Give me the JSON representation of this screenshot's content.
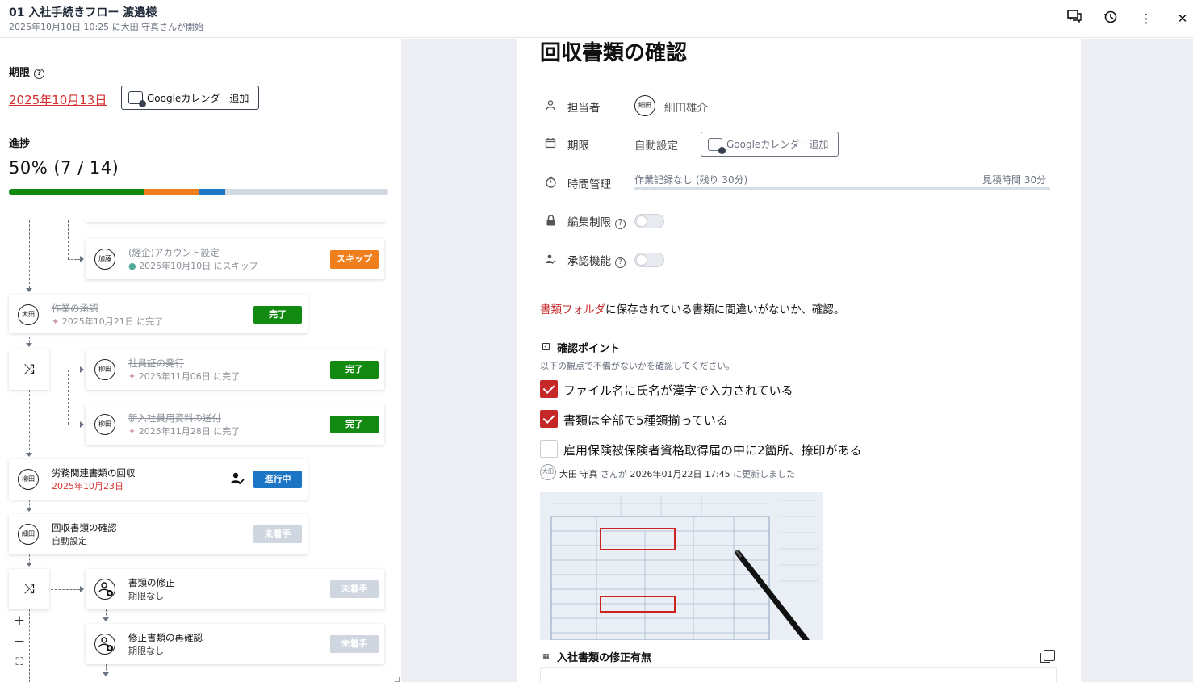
{
  "header": {
    "title": "01 入社手続きフロー 渡邉様",
    "subtitle": "2025年10月10日 10:25 に大田 守真さんが開始"
  },
  "sidebar": {
    "deadline_label": "期限",
    "deadline_value": "2025年10月13日",
    "gcal_label": "Googleカレンダー追加",
    "progress_label": "進捗",
    "progress_text": "50% (7 / 14)",
    "progress": {
      "done": 7,
      "total": 14,
      "segments": {
        "done_fraction": 0.357,
        "skipped_fraction": 0.143,
        "in_progress_fraction": 0.071
      }
    },
    "progress_colors": {
      "done": "#128a12",
      "skipped": "#ef7e1c",
      "in_progress": "#1b74c4",
      "remaining": "#d1d9e2"
    }
  },
  "flow": {
    "nodes": [
      {
        "avatar": "加藤",
        "title": "(経企)アカウント設定",
        "sub": "2025年10月10日 にスキップ",
        "status": "スキップ"
      },
      {
        "avatar": "大田",
        "title": "作業の承認",
        "sub": "2025年10月21日 に完了",
        "status": "完了"
      },
      {
        "avatar": "柳田",
        "title": "社員証の発行",
        "sub": "2025年11月06日 に完了",
        "status": "完了"
      },
      {
        "avatar": "柳田",
        "title": "新入社員用資料の送付",
        "sub": "2025年11月28日 に完了",
        "status": "完了"
      },
      {
        "avatar": "柳田",
        "title": "労務関連書類の回収",
        "sub": "2025年10月23日",
        "status": "進行中"
      },
      {
        "avatar": "細田",
        "title": "回収書類の確認",
        "sub": "自動設定",
        "status": "未着手"
      },
      {
        "avatar": "",
        "title": "書類の修正",
        "sub": "期限なし",
        "status": "未着手"
      },
      {
        "avatar": "",
        "title": "修正書類の再確認",
        "sub": "期限なし",
        "status": "未着手"
      }
    ],
    "zoom": {
      "in": "+",
      "out": "−",
      "fit": "⛶"
    }
  },
  "panel": {
    "title": "回収書類の確認",
    "assignee_label": "担当者",
    "assignee_avatar": "細田",
    "assignee_name": "細田雄介",
    "deadline_label": "期限",
    "deadline_value": "自動設定",
    "gcal_label": "Googleカレンダー追加",
    "time_label": "時間管理",
    "time_record": "作業記録なし (残り 30分)",
    "time_estimate": "見積時間 30分",
    "edit_limit_label": "編集制限",
    "approval_label": "承認機能",
    "description_link": "書類フォルダ",
    "description_rest": "に保存されている書類に間違いがないか、確認。",
    "check_title": "確認ポイント",
    "check_hint": "以下の観点で不備がないかを確認してください。",
    "checks": [
      {
        "label": "ファイル名に氏名が漢字で入力されている",
        "checked": true
      },
      {
        "label": "書類は全部で5種類揃っている",
        "checked": true
      },
      {
        "label": "雇用保険被保険者資格取得届の中に2箇所、捺印がある",
        "checked": false
      }
    ],
    "updated_avatar": "大田",
    "updated_by": "大田 守真",
    "updated_mid": "さんが",
    "updated_at": "2026年01月22日 17:45",
    "updated_suffix": "に更新しました",
    "section2_title": "入社書類の修正有無"
  },
  "colors": {
    "accent_red": "#c62828",
    "deadline_red": "#d32f2f",
    "done_green": "#128a12",
    "skip_orange": "#ef7e1c",
    "progress_blue": "#1b74c4"
  }
}
